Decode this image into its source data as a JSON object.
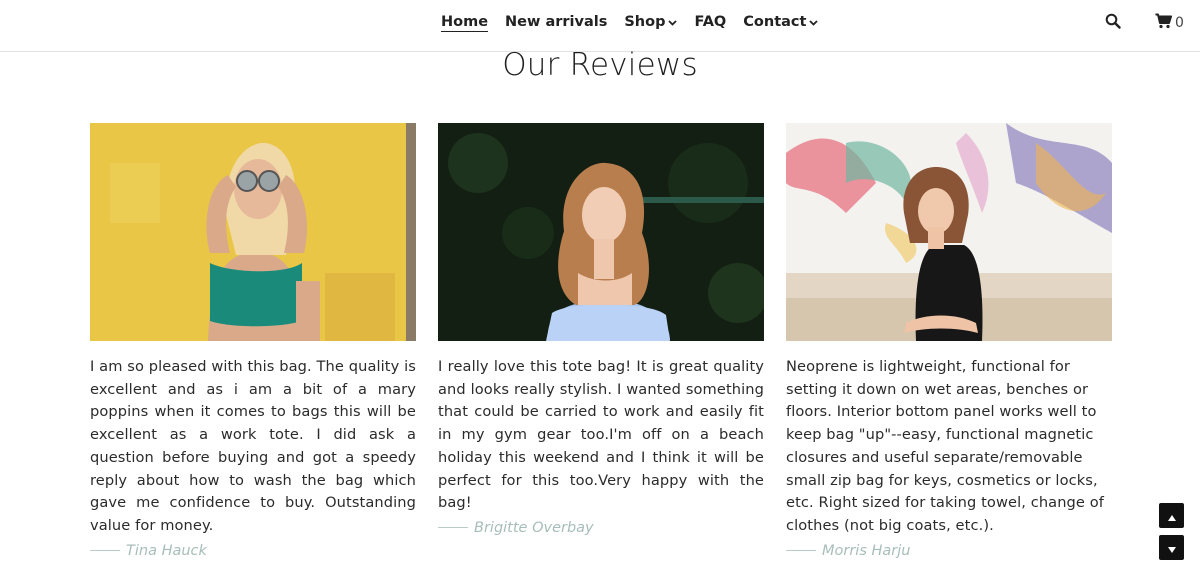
{
  "nav": {
    "items": [
      {
        "label": "Home",
        "active": true,
        "dropdown": false
      },
      {
        "label": "New arrivals",
        "active": false,
        "dropdown": false
      },
      {
        "label": "Shop",
        "active": false,
        "dropdown": true
      },
      {
        "label": "FAQ",
        "active": false,
        "dropdown": false
      },
      {
        "label": "Contact",
        "active": false,
        "dropdown": true
      }
    ],
    "search_icon": "search-icon",
    "cart_icon": "cart-icon",
    "cart_count": "0"
  },
  "section": {
    "title": "Our Reviews"
  },
  "reviews": [
    {
      "text": "I am so pleased with this bag. The quality is excellent and as i am a bit of a mary poppins when it comes to bags this will be excellent as a work tote. I did ask a question before buying and got a speedy reply about how to wash the bag which gave me confidence to buy. Outstanding value for money.",
      "author": "Tina Hauck",
      "photo": "woman in green top against yellow wall holding sunglasses"
    },
    {
      "text": "I really love this tote bag! It is great quality and looks really stylish. I wanted something that could be carried to work and easily fit in my gym gear too.I'm off on a beach holiday this weekend and I think it will be perfect for this too.Very happy with the bag!",
      "author": "Brigitte Overbay",
      "photo": "woman in light blue dress in dark garden"
    },
    {
      "text": "Neoprene is lightweight, functional for setting it down on wet areas, benches or floors. Interior bottom panel works well to keep bag \"up\"--easy, functional magnetic closures and useful separate/removable small zip bag for keys, cosmetics or locks, etc. Right sized for taking towel, change of clothes (not big coats, etc.).",
      "author": "Morris Harju",
      "photo": "woman in black lace dress sitting in front of mural"
    }
  ],
  "colors": {
    "author": "#a7bdb9",
    "text": "#2b2b2b",
    "nav_border": "#e2e2e2"
  },
  "controls": {
    "scroll_up_icon": "arrow-up-icon",
    "scroll_down_icon": "arrow-down-icon"
  }
}
